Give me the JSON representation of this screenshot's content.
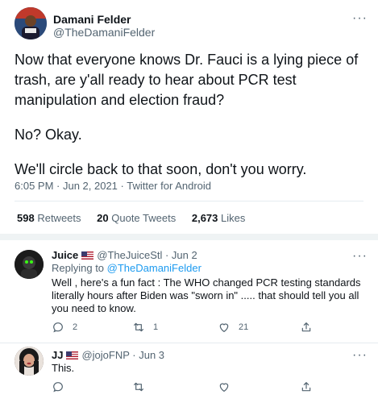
{
  "main_tweet": {
    "author_name": "Damani Felder",
    "author_handle": "@TheDamaniFelder",
    "text_paragraphs": [
      "Now that everyone knows Dr. Fauci is a lying piece of trash, are y'all ready to hear about PCR test manipulation and election fraud?",
      "No? Okay.",
      "We'll circle back to that soon, don't you worry."
    ],
    "timestamp": "6:05 PM · Jun 2, 2021 · Twitter for Android",
    "stats": {
      "retweets_count": "598",
      "retweets_label": "Retweets",
      "quotes_count": "20",
      "quotes_label": "Quote Tweets",
      "likes_count": "2,673",
      "likes_label": "Likes"
    },
    "more_label": "···"
  },
  "replies": [
    {
      "author_name": "Juice",
      "author_handle": "@TheJuiceStl · Jun 2",
      "replying_prefix": "Replying to ",
      "replying_to": "@TheDamaniFelder",
      "text": "Well , here's a fun fact : The WHO changed PCR testing standards literally hours after Biden was \"sworn in\" ..... that should tell you all you need to know.",
      "reply_count": "2",
      "retweet_count": "1",
      "like_count": "21",
      "more_label": "···"
    },
    {
      "author_name": "JJ",
      "author_handle": "@jojoFNP · Jun 3",
      "text": "This.",
      "reply_count": "",
      "retweet_count": "",
      "like_count": "",
      "more_label": "···"
    }
  ],
  "colors": {
    "link_blue": "#1d9bf0",
    "secondary_text": "#536471",
    "primary_text": "#0f1419",
    "divider": "#e6ecf0"
  }
}
